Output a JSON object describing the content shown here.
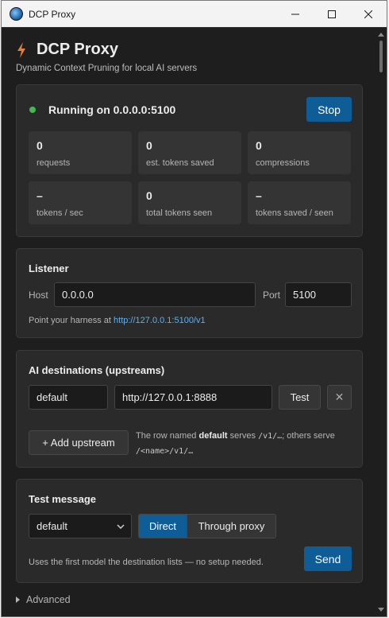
{
  "window": {
    "title": "DCP Proxy"
  },
  "header": {
    "title": "DCP Proxy",
    "subtitle": "Dynamic Context Pruning for local AI servers"
  },
  "status": {
    "text": "Running on 0.0.0.0:5100",
    "indicator_color": "#3fb950",
    "stop_label": "Stop",
    "stats": [
      {
        "value": "0",
        "label": "requests"
      },
      {
        "value": "0",
        "label": "est. tokens saved"
      },
      {
        "value": "0",
        "label": "compressions"
      },
      {
        "value": "–",
        "label": "tokens / sec"
      },
      {
        "value": "0",
        "label": "total tokens seen"
      },
      {
        "value": "–",
        "label": "tokens saved / seen"
      }
    ]
  },
  "listener": {
    "title": "Listener",
    "host_label": "Host",
    "host_value": "0.0.0.0",
    "port_label": "Port",
    "port_value": "5100",
    "hint_prefix": "Point your harness at ",
    "hint_link": "http://127.0.0.1:5100/v1"
  },
  "upstreams": {
    "title": "AI destinations (upstreams)",
    "rows": [
      {
        "name": "default",
        "url": "http://127.0.0.1:8888",
        "test_label": "Test",
        "remove_label": "✕"
      }
    ],
    "add_label": "+ Add upstream",
    "hint_part1": "The row named ",
    "hint_bold": "default",
    "hint_part2": " serves ",
    "hint_code1": "/v1/…",
    "hint_part3": "; others serve",
    "hint_code2": "/<name>/v1/…"
  },
  "test_message": {
    "title": "Test message",
    "selected_destination": "default",
    "mode_direct": "Direct",
    "mode_proxy": "Through proxy",
    "hint": "Uses the first model the destination lists — no setup needed.",
    "send_label": "Send"
  },
  "advanced": {
    "label": "Advanced"
  },
  "colors": {
    "accent": "#0e5d96",
    "background": "#1e1e1e",
    "card": "#2a2a2a",
    "link": "#5ab0f0",
    "bolt": "#f07b2e"
  }
}
